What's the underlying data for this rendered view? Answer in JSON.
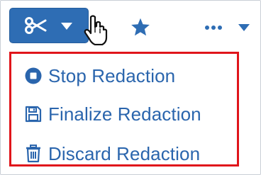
{
  "toolbar": {
    "redact_icon": "scissors-icon",
    "redact_dropdown_icon": "caret-down-icon",
    "favorite_icon": "star-icon",
    "more_icon": "ellipsis-icon",
    "more_dropdown_icon": "caret-down-icon"
  },
  "menu": {
    "items": [
      {
        "label": "Stop Redaction",
        "icon": "stop-circle-icon"
      },
      {
        "label": "Finalize Redaction",
        "icon": "save-icon"
      },
      {
        "label": "Discard Redaction",
        "icon": "trash-icon"
      }
    ]
  },
  "colors": {
    "accent": "#2e6db4",
    "menu_text": "#2a65ad",
    "highlight_border": "#e0151b"
  }
}
